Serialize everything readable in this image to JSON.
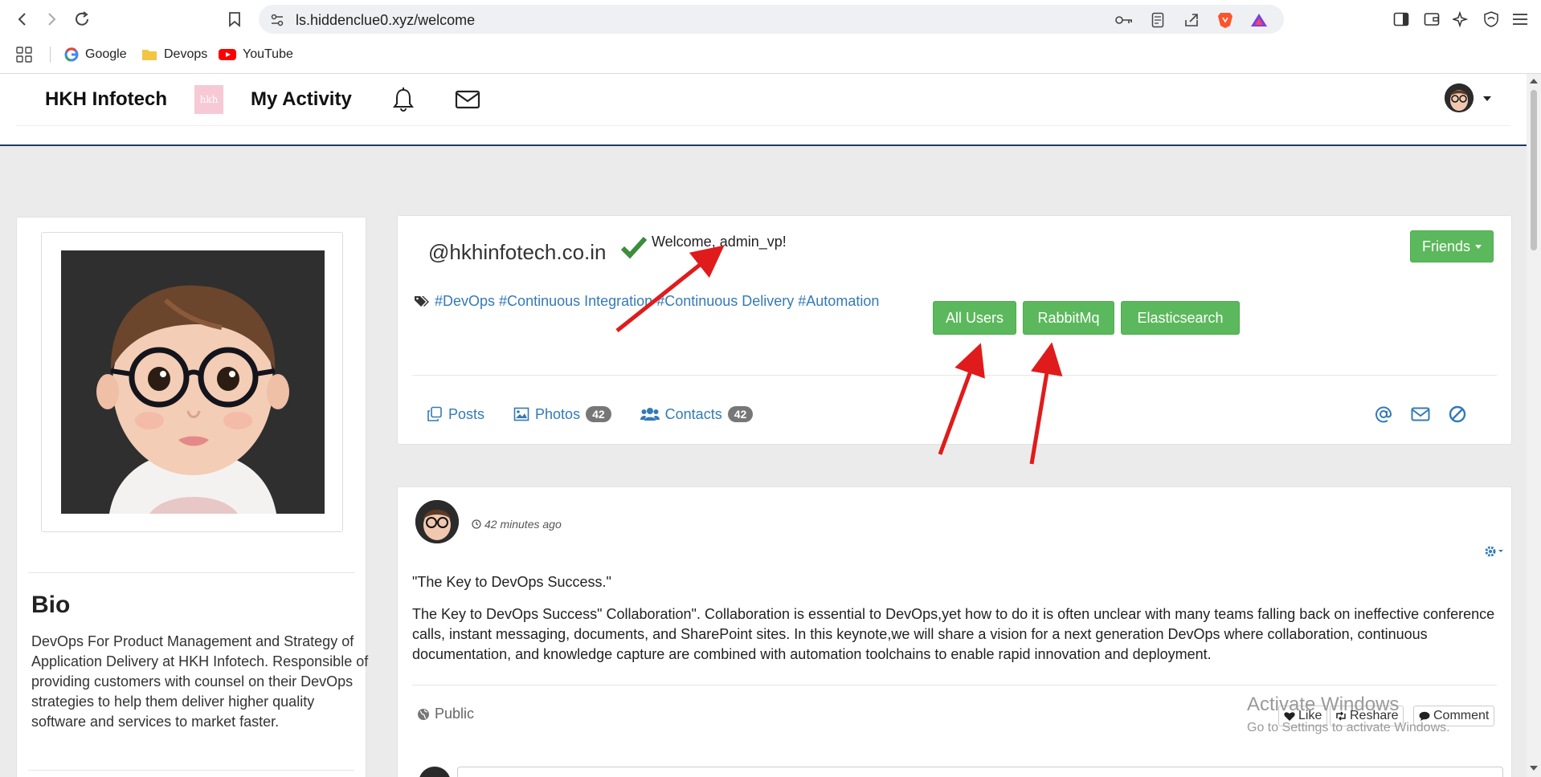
{
  "browser": {
    "url": "ls.hiddenclue0.xyz/welcome",
    "bookmarks": [
      {
        "label": "Google",
        "icon": "google-icon"
      },
      {
        "label": "Devops",
        "icon": "folder-icon"
      },
      {
        "label": "YouTube",
        "icon": "youtube-icon"
      }
    ]
  },
  "navbar": {
    "brand": "HKH Infotech",
    "logo_text": "hkh",
    "activity": "My Activity"
  },
  "profile": {
    "bio_title": "Bio",
    "bio_text": "DevOps For Product Management and Strategy of Application Delivery at HKH Infotech. Responsible of providing customers with counsel on their DevOps strategies to help them deliver higher quality software and services to market faster."
  },
  "header": {
    "handle": "@hkhinfotech.co.in",
    "welcome": "Welcome, admin_vp!",
    "friends_label": "Friends",
    "tags": [
      "#DevOps",
      "#Continuous Integration",
      "#Continuous Delivery",
      "#Automation"
    ],
    "buttons": [
      "All Users",
      "RabbitMq",
      "Elasticsearch"
    ],
    "tabs": {
      "posts": "Posts",
      "photos": "Photos",
      "photos_count": "42",
      "contacts": "Contacts",
      "contacts_count": "42"
    }
  },
  "post": {
    "time": "42 minutes ago",
    "title": "\"The Key to DevOps Success.\"",
    "body": "The Key to DevOps Success\" Collaboration\". Collaboration is essential to DevOps,yet how to do it is often unclear with many teams falling back on ineffective conference calls, instant messaging, documents, and SharePoint sites. In this keynote,we will share a vision for a next generation DevOps where collaboration, continuous documentation, and knowledge capture are combined with automation toolchains to enable rapid innovation and deployment.",
    "visibility": "Public",
    "like": "Like",
    "reshare": "Reshare",
    "comment": "Comment"
  },
  "watermark": {
    "line1": "Activate Windows",
    "line2": "Go to Settings to activate Windows."
  },
  "colors": {
    "green": "#5cb85c",
    "link": "#337ab7",
    "arrow": "#e01b1b"
  }
}
